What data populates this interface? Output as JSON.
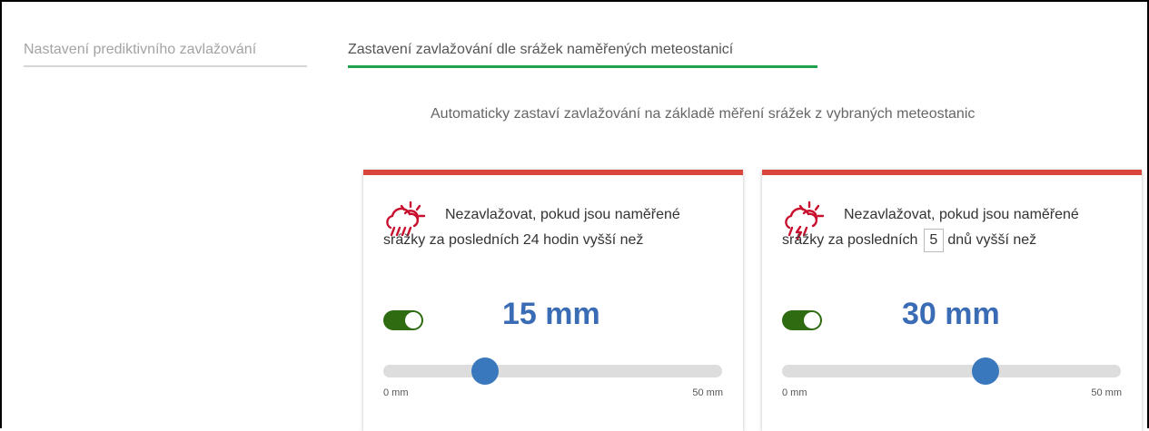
{
  "tabs": [
    {
      "label": "Nastavení prediktivního zavlažování",
      "active": false
    },
    {
      "label": "Zastavení zavlažování dle srážek naměřených meteostanicí",
      "active": true
    }
  ],
  "subtitle": "Automaticky zastaví zavlažování na základě měření srážek z vybraných meteostanic",
  "colors": {
    "card_top_border": "#d9463c",
    "active_tab_underline": "#1fa34a",
    "toggle_on": "#2f6b10",
    "value_text": "#3a6bb5",
    "slider_thumb": "#3a78be",
    "icon": "#c8102e"
  },
  "cards": [
    {
      "icon": "rain-sun-icon",
      "description": "Nezavlažovat, pokud jsou naměřené srážky za posledních 24 hodin vyšší než",
      "toggle_on": true,
      "value_label": "15 mm",
      "slider": {
        "value": 15,
        "min": 0,
        "max": 50,
        "min_label": "0 mm",
        "max_label": "50 mm"
      }
    },
    {
      "icon": "storm-sun-icon",
      "description_before": "Nezavlažovat, pokud jsou naměřené srážky za posledních",
      "days_value": "5",
      "description_after": "dnů vyšší než",
      "toggle_on": true,
      "value_label": "30 mm",
      "slider": {
        "value": 30,
        "min": 0,
        "max": 50,
        "min_label": "0 mm",
        "max_label": "50 mm"
      }
    }
  ]
}
